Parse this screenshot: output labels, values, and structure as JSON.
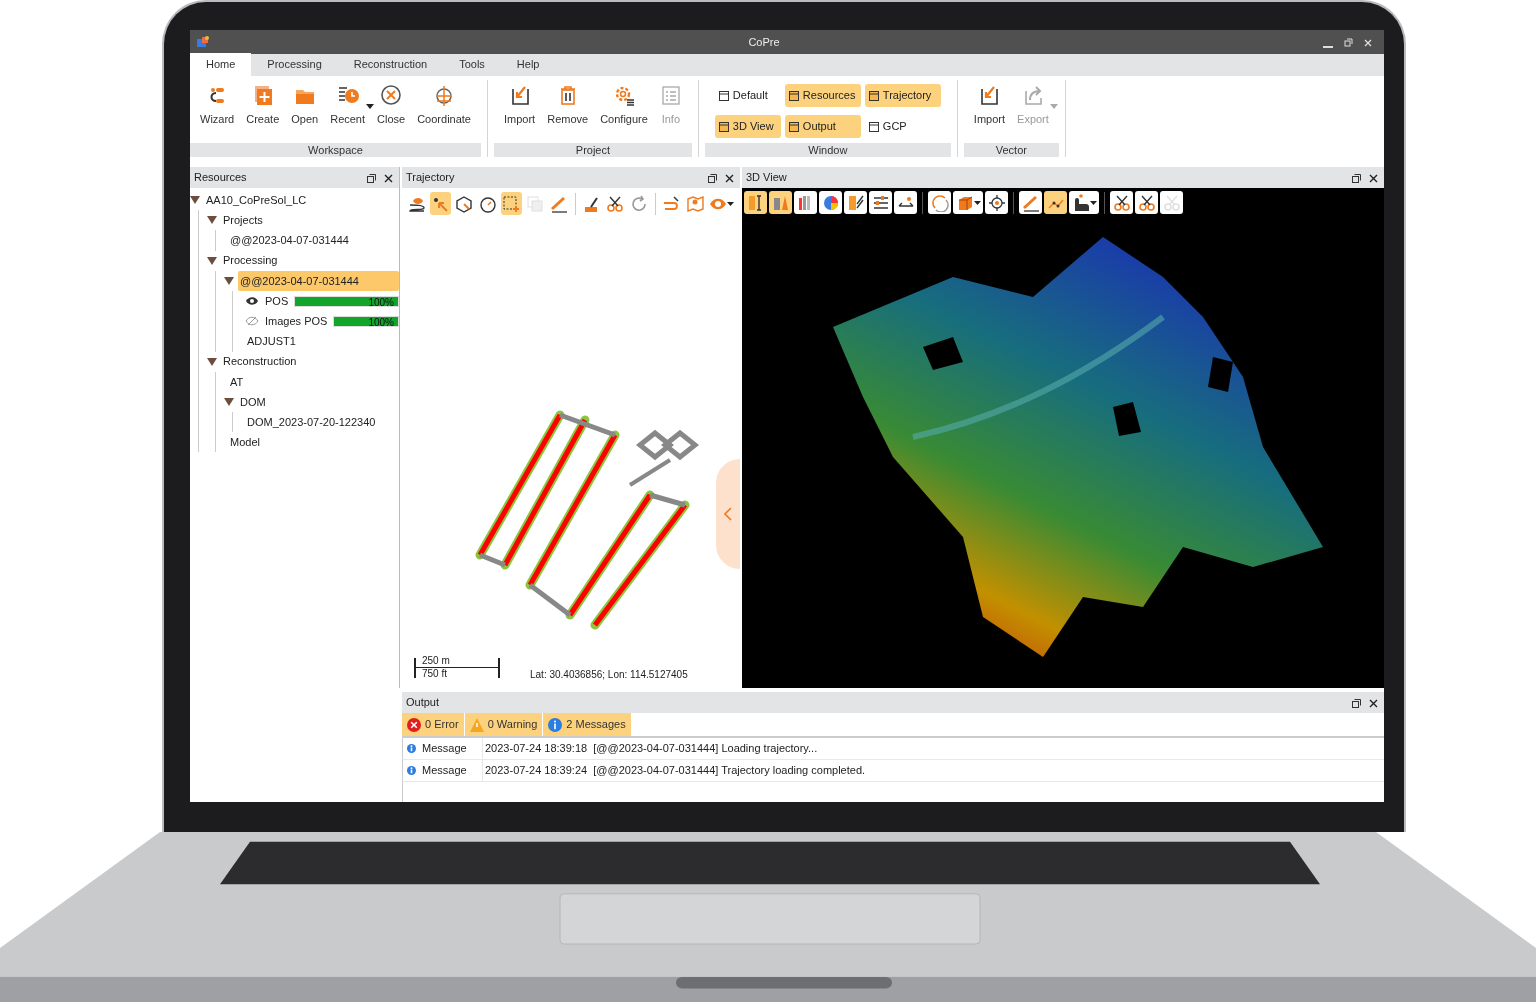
{
  "window": {
    "title": "CoPre"
  },
  "menu_tabs": [
    {
      "label": "Home",
      "selected": true
    },
    {
      "label": "Processing",
      "selected": false
    },
    {
      "label": "Reconstruction",
      "selected": false
    },
    {
      "label": "Tools",
      "selected": false
    },
    {
      "label": "Help",
      "selected": false
    }
  ],
  "ribbon": {
    "groups": [
      {
        "title": "Workspace",
        "kind": "large",
        "items": [
          {
            "label": "Wizard",
            "disabled": false,
            "dropdown": false
          },
          {
            "label": "Create",
            "disabled": false,
            "dropdown": false
          },
          {
            "label": "Open",
            "disabled": false,
            "dropdown": false
          },
          {
            "label": "Recent",
            "disabled": false,
            "dropdown": true
          },
          {
            "label": "Close",
            "disabled": false,
            "dropdown": false
          },
          {
            "label": "Coordinate",
            "disabled": false,
            "dropdown": false
          }
        ]
      },
      {
        "title": "Project",
        "kind": "large",
        "items": [
          {
            "label": "Import",
            "disabled": false,
            "dropdown": false
          },
          {
            "label": "Remove",
            "disabled": false,
            "dropdown": false
          },
          {
            "label": "Configure",
            "disabled": false,
            "dropdown": false
          },
          {
            "label": "Info",
            "disabled": true,
            "dropdown": false
          }
        ]
      },
      {
        "title": "Window",
        "kind": "toggles",
        "items": [
          {
            "label": "Default",
            "on": false
          },
          {
            "label": "Resources",
            "on": true
          },
          {
            "label": "Trajectory",
            "on": true
          },
          {
            "label": "3D View",
            "on": true
          },
          {
            "label": "Output",
            "on": true
          },
          {
            "label": "GCP",
            "on": false
          }
        ]
      },
      {
        "title": "Vector",
        "kind": "large",
        "items": [
          {
            "label": "Import",
            "disabled": false,
            "dropdown": false
          },
          {
            "label": "Export",
            "disabled": true,
            "dropdown": true
          }
        ]
      }
    ]
  },
  "resources": {
    "title": "Resources",
    "tree": [
      {
        "label": "AA10_CoPreSol_LC",
        "expanded": true,
        "selected": false,
        "children": [
          {
            "label": "Projects",
            "expanded": true,
            "selected": false,
            "children": [
              {
                "label": "@@2023-04-07-031444",
                "selected": false
              }
            ]
          },
          {
            "label": "Processing",
            "expanded": true,
            "selected": false,
            "children": [
              {
                "label": "@@2023-04-07-031444",
                "expanded": true,
                "selected": true,
                "children": [
                  {
                    "label": "POS",
                    "kind": "progress",
                    "visible": true,
                    "level": 1,
                    "reading": "100%",
                    "selected": false
                  },
                  {
                    "label": "Images POS",
                    "kind": "progress",
                    "visible": false,
                    "level": 1,
                    "reading": "100%",
                    "selected": false
                  },
                  {
                    "label": "ADJUST1",
                    "selected": false
                  }
                ]
              }
            ]
          },
          {
            "label": "Reconstruction",
            "expanded": true,
            "selected": false,
            "children": [
              {
                "label": "AT",
                "selected": false
              },
              {
                "label": "DOM",
                "expanded": true,
                "selected": false,
                "children": [
                  {
                    "label": "DOM_2023-07-20-122340",
                    "selected": false
                  }
                ]
              },
              {
                "label": "Model",
                "selected": false
              }
            ]
          }
        ]
      }
    ]
  },
  "trajectory": {
    "title": "Trajectory",
    "toolbar_groups": [
      {
        "tools": [
          {
            "active": false,
            "disabled": false,
            "dropdown": false
          },
          {
            "active": true,
            "disabled": false,
            "dropdown": false
          },
          {
            "active": false,
            "disabled": false,
            "dropdown": false
          },
          {
            "active": false,
            "disabled": false,
            "dropdown": false
          },
          {
            "active": true,
            "disabled": false,
            "dropdown": false
          },
          {
            "active": false,
            "disabled": true,
            "dropdown": false
          },
          {
            "active": false,
            "disabled": false,
            "dropdown": false
          }
        ]
      },
      {
        "tools": [
          {
            "active": false,
            "disabled": false,
            "dropdown": false
          },
          {
            "active": false,
            "disabled": false,
            "dropdown": false
          },
          {
            "active": false,
            "disabled": false,
            "dropdown": false
          }
        ]
      },
      {
        "tools": [
          {
            "active": false,
            "disabled": false,
            "dropdown": false
          },
          {
            "active": false,
            "disabled": false,
            "dropdown": false
          },
          {
            "active": false,
            "disabled": false,
            "dropdown": true
          }
        ]
      }
    ],
    "scale": {
      "metric": "250 m",
      "imperial": "750 ft"
    },
    "coordinates": "Lat: 30.4036856; Lon: 114.5127405"
  },
  "view3d": {
    "title": "3D View",
    "toolbar_groups": [
      {
        "tools": [
          {
            "active": true,
            "disabled": false,
            "dropdown": false
          },
          {
            "active": true,
            "disabled": false,
            "dropdown": false
          },
          {
            "active": false,
            "disabled": false,
            "dropdown": false
          },
          {
            "active": false,
            "disabled": false,
            "dropdown": false
          },
          {
            "active": false,
            "disabled": false,
            "dropdown": false
          },
          {
            "active": false,
            "disabled": false,
            "dropdown": false
          },
          {
            "active": false,
            "disabled": false,
            "dropdown": false
          }
        ]
      },
      {
        "tools": [
          {
            "active": false,
            "disabled": false,
            "dropdown": false
          },
          {
            "active": false,
            "disabled": false,
            "dropdown": true
          },
          {
            "active": false,
            "disabled": false,
            "dropdown": false
          }
        ]
      },
      {
        "tools": [
          {
            "active": false,
            "disabled": false,
            "dropdown": false
          },
          {
            "active": true,
            "disabled": false,
            "dropdown": false
          },
          {
            "active": false,
            "disabled": false,
            "dropdown": true
          }
        ]
      },
      {
        "tools": [
          {
            "active": false,
            "disabled": false,
            "dropdown": false
          },
          {
            "active": false,
            "disabled": false,
            "dropdown": false
          },
          {
            "active": false,
            "disabled": true,
            "dropdown": false
          }
        ]
      }
    ]
  },
  "output": {
    "title": "Output",
    "filters": [
      {
        "kind": "error",
        "label": "0 Error"
      },
      {
        "kind": "warning",
        "label": "0 Warning"
      },
      {
        "kind": "info",
        "label": "2 Messages"
      }
    ],
    "rows": [
      {
        "kind": "info",
        "type": "Message",
        "text": "2023-07-24 18:39:18  [@@2023-04-07-031444] Loading trajectory..."
      },
      {
        "kind": "info",
        "type": "Message",
        "text": "2023-07-24 18:39:24  [@@2023-04-07-031444] Trajectory loading completed."
      }
    ]
  }
}
